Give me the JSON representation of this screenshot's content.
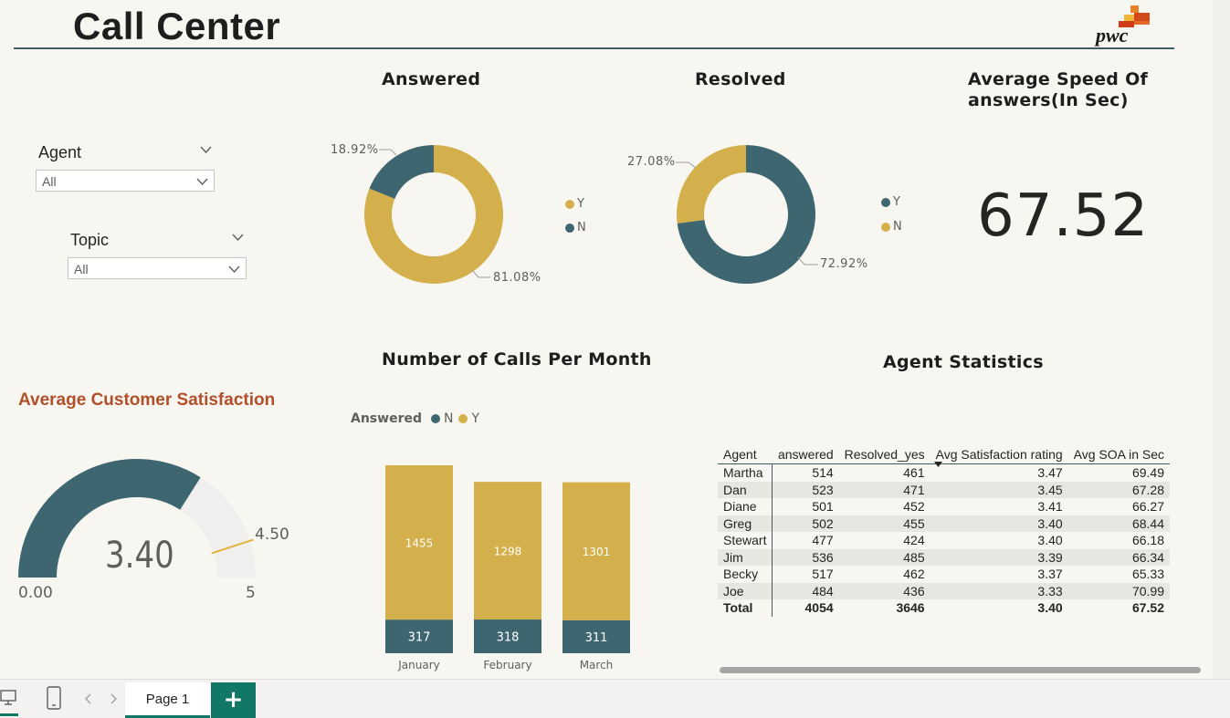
{
  "report_title": "Call Center",
  "logo": {
    "text": "pwc"
  },
  "slicers": {
    "agent": {
      "label": "Agent",
      "value": "All"
    },
    "topic": {
      "label": "Topic",
      "value": "All"
    }
  },
  "answered": {
    "title": "Answered",
    "slices": [
      {
        "name": "Y",
        "value": 81.08,
        "label": "81.08%",
        "color": "#d4b04c"
      },
      {
        "name": "N",
        "value": 18.92,
        "label": "18.92%",
        "color": "#3e6670"
      }
    ]
  },
  "resolved": {
    "title": "Resolved",
    "slices": [
      {
        "name": "Y",
        "value": 72.92,
        "label": "72.92%",
        "color": "#3e6670"
      },
      {
        "name": "N",
        "value": 27.08,
        "label": "27.08%",
        "color": "#d4b04c"
      }
    ]
  },
  "speed": {
    "title_line1": "Average Speed Of",
    "title_line2": "answers(In Sec)",
    "value": "67.52"
  },
  "satisfaction": {
    "title": "Average Customer Satisfaction",
    "value": 3.4,
    "value_label": "3.40",
    "min": 0,
    "min_label": "0.00",
    "max": 5,
    "max_label": "5",
    "target": 4.5,
    "target_label": "4.50",
    "fill_color": "#3e6670",
    "track_color": "#f0efed",
    "target_color": "#e0b43c"
  },
  "calls": {
    "title": "Number of Calls Per Month",
    "legend_title": "Answered",
    "legend": [
      {
        "name": "N",
        "color": "#3e6670"
      },
      {
        "name": "Y",
        "color": "#d4b04c"
      }
    ]
  },
  "chart_data": {
    "type": "bar",
    "stacked": true,
    "categories": [
      "January",
      "February",
      "March"
    ],
    "series": [
      {
        "name": "N",
        "values": [
          317,
          318,
          311
        ],
        "color": "#3e6670"
      },
      {
        "name": "Y",
        "values": [
          1455,
          1298,
          1301
        ],
        "color": "#d4b04c"
      }
    ],
    "legend_title": "Answered",
    "data_labels": true,
    "grid": false
  },
  "agent_stats": {
    "title": "Agent Statistics",
    "columns": [
      "Agent",
      "answered",
      "Resolved_yes",
      "Avg Satisfaction rating",
      "Avg SOA in Sec"
    ],
    "rows": [
      [
        "Martha",
        "514",
        "461",
        "3.47",
        "69.49"
      ],
      [
        "Dan",
        "523",
        "471",
        "3.45",
        "67.28"
      ],
      [
        "Diane",
        "501",
        "452",
        "3.41",
        "66.27"
      ],
      [
        "Greg",
        "502",
        "455",
        "3.40",
        "68.44"
      ],
      [
        "Stewart",
        "477",
        "424",
        "3.40",
        "66.18"
      ],
      [
        "Jim",
        "536",
        "485",
        "3.39",
        "66.34"
      ],
      [
        "Becky",
        "517",
        "462",
        "3.37",
        "65.33"
      ],
      [
        "Joe",
        "484",
        "436",
        "3.33",
        "70.99"
      ]
    ],
    "total": [
      "Total",
      "4054",
      "3646",
      "3.40",
      "67.52"
    ]
  },
  "pages": {
    "tab_label": "Page 1",
    "add_label": "+"
  }
}
